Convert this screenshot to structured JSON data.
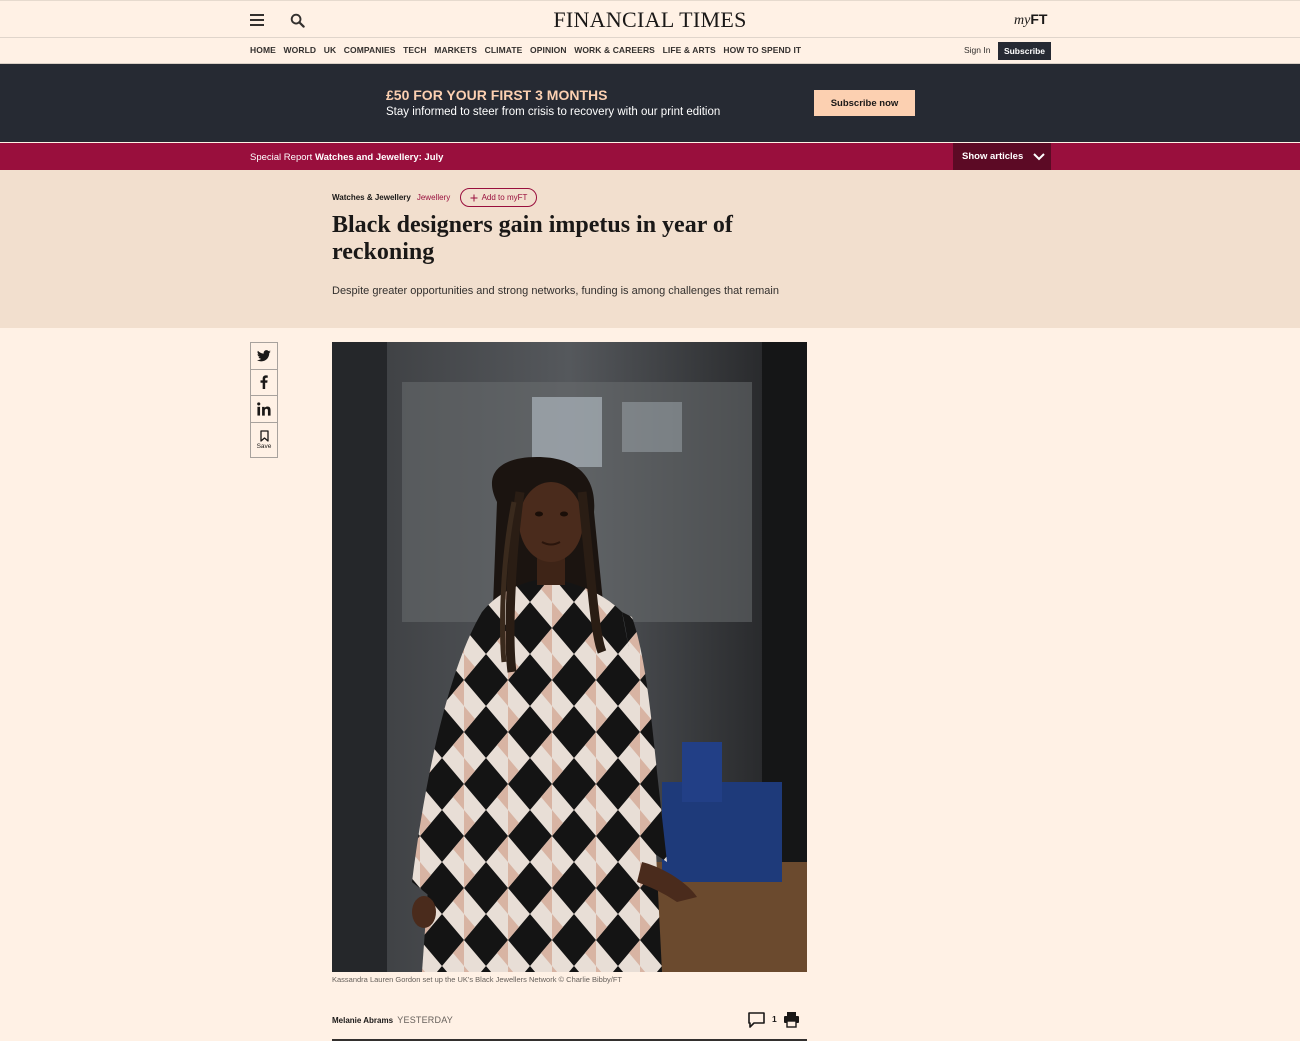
{
  "header": {
    "logo": "FINANCIAL TIMES",
    "myft_prefix": "my",
    "myft_suffix": "FT"
  },
  "nav": {
    "items": [
      "HOME",
      "WORLD",
      "UK",
      "COMPANIES",
      "TECH",
      "MARKETS",
      "CLIMATE",
      "OPINION",
      "WORK & CAREERS",
      "LIFE & ARTS",
      "HOW TO SPEND IT"
    ],
    "sign_in": "Sign In",
    "subscribe": "Subscribe"
  },
  "promo": {
    "headline": "£50 FOR YOUR FIRST 3 MONTHS",
    "subtext": "Stay informed to steer from crisis to recovery with our print edition",
    "button": "Subscribe now"
  },
  "special_report": {
    "prefix": "Special Report",
    "title": "Watches and Jewellery: July",
    "show_articles": "Show articles"
  },
  "article": {
    "tag_primary": "Watches & Jewellery",
    "tag_secondary": "Jewellery",
    "add_to_myft": "Add to myFT",
    "headline": "Black designers gain impetus in year of reckoning",
    "standfirst": "Despite greater opportunities and strong networks, funding is among challenges that remain",
    "caption": "Kassandra Lauren Gordon set up the UK's Black Jewellers Network © Charlie Bibby/FT",
    "author": "Melanie Abrams",
    "timestamp": "YESTERDAY",
    "comment_count": "1"
  },
  "share": {
    "save_label": "Save",
    "icons": [
      "twitter-icon",
      "facebook-icon",
      "linkedin-icon",
      "bookmark-icon"
    ]
  },
  "colors": {
    "background": "#fff1e5",
    "claret": "#990f3d",
    "dark": "#262a33",
    "promo_accent": "#fcd0b1",
    "article_head": "#f2dfce"
  }
}
